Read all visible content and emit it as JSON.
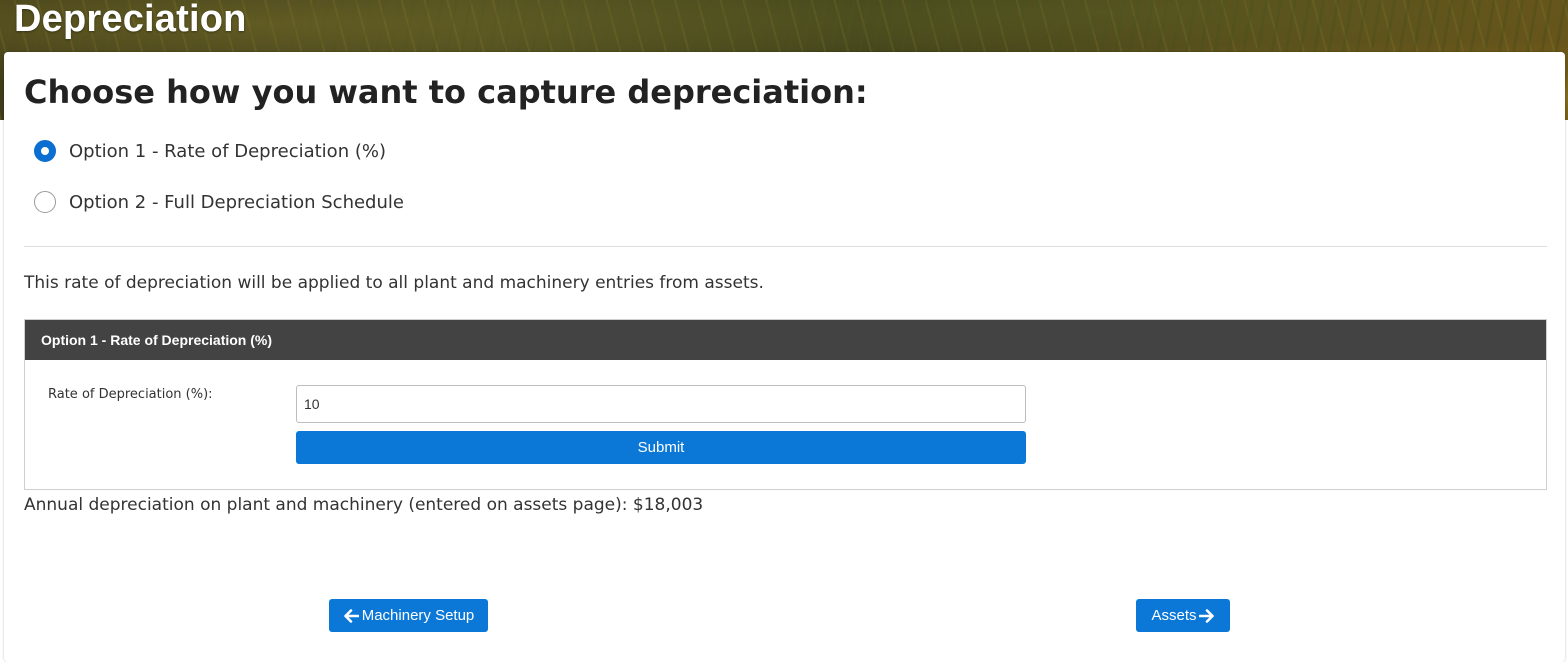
{
  "banner": {
    "title": "Depreciation"
  },
  "heading": "Choose how you want to capture depreciation:",
  "options": [
    {
      "label": "Option 1 - Rate of Depreciation (%)",
      "checked": true
    },
    {
      "label": "Option 2 - Full Depreciation Schedule",
      "checked": false
    }
  ],
  "description": "This rate of depreciation will be applied to all plant and machinery entries from assets.",
  "panel": {
    "title": "Option 1 - Rate of Depreciation (%)",
    "field_label": "Rate of Depreciation (%):",
    "field_value": "10",
    "submit_label": "Submit"
  },
  "annual_text": "Annual depreciation on plant and machinery (entered on assets page): $18,003",
  "nav": {
    "back_label": "Machinery Setup",
    "back_icon": "arrow-left-icon",
    "next_label": "Assets",
    "next_icon": "arrow-right-icon"
  },
  "colors": {
    "accent": "#0b78d8",
    "radio_selected": "#0b6fd1",
    "panel_header": "#434343"
  }
}
